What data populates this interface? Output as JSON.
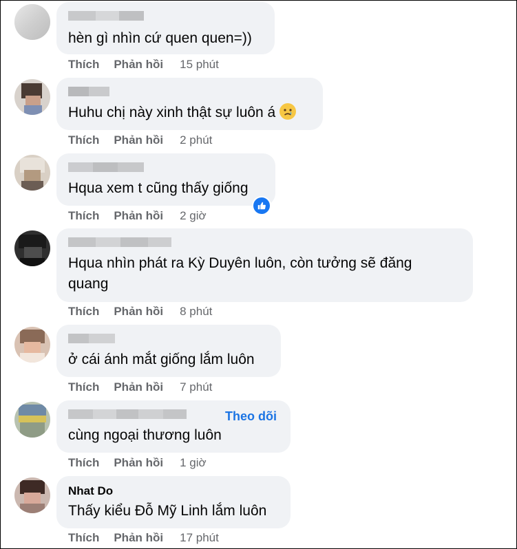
{
  "labels": {
    "like": "Thích",
    "reply": "Phản hồi"
  },
  "comments": [
    {
      "text": "hèn gì nhìn cứ quen quen=))",
      "time": "15 phút"
    },
    {
      "text": "Huhu chị này xinh thật sự luôn á",
      "emoji": "sad-face-emoji",
      "time": "2 phút"
    },
    {
      "text": "Hqua xem t cũng thấy giống",
      "reaction": "like-reaction-icon",
      "time": "2 giờ"
    },
    {
      "text_line1": "Hqua nhìn phát ra Kỳ Duyên luôn, còn tưởng sẽ đăng",
      "text_line2": "quang",
      "time": "8 phút"
    },
    {
      "text": "ở cái ánh mắt giống lắm luôn",
      "time": "7 phút"
    },
    {
      "text": "cùng ngoại thương luôn",
      "follow": "Theo dõi",
      "time": "1 giờ"
    },
    {
      "author": "Nhat Do",
      "text": "Thấy kiểu Đỗ Mỹ Linh lắm luôn",
      "time": "17 phút"
    }
  ],
  "colors": {
    "bubble": "#f0f2f5",
    "meta": "#65676b",
    "link": "#1b74e4",
    "like": "#1877f2"
  }
}
